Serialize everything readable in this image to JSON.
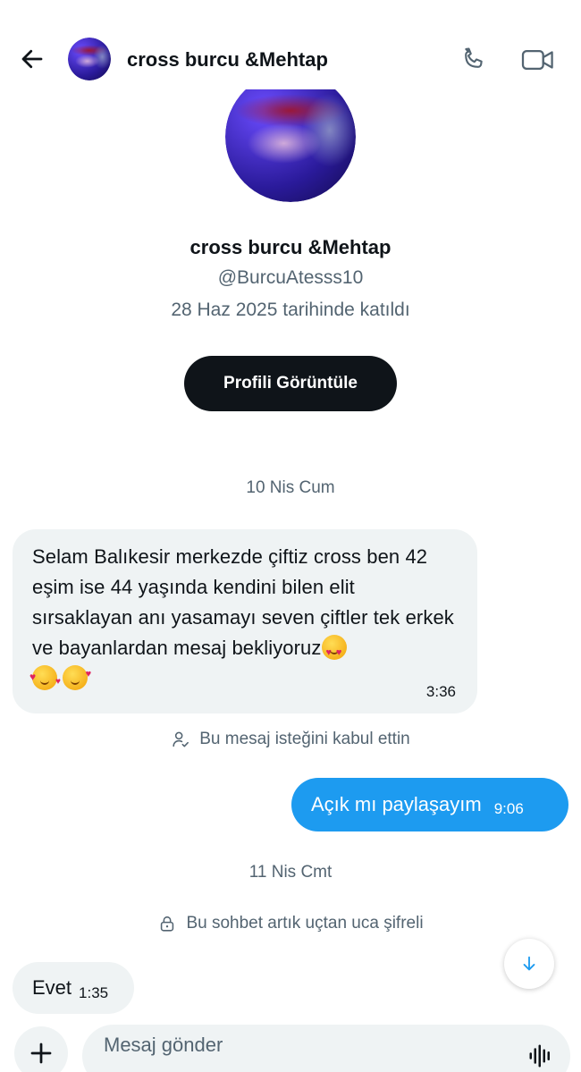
{
  "header": {
    "title": "cross burcu &Mehtap",
    "back_icon": "arrow-left-icon",
    "call_icon": "phone-icon",
    "video_icon": "video-camera-icon"
  },
  "profile": {
    "name": "cross burcu &Mehtap",
    "handle": "@BurcuAtesss10",
    "joined": "28 Haz 2025 tarihinde katıldı",
    "view_button": "Profili Görüntüle"
  },
  "conversation": {
    "date_1": "10 Nis Cum",
    "message_1": {
      "text": "Selam Balıkesir merkezde çiftiz cross ben 42 eşim ise 44 yaşında kendini bilen elit sırsaklayan anı yasamayı seven çiftler tek erkek ve bayanlardan mesaj bekliyoruz",
      "emojis": [
        "smiling-face-heart-eyes",
        "smiling-face-hearts",
        "face-blowing-kiss"
      ],
      "time": "3:36"
    },
    "accepted_note": "Bu mesaj isteğini kabul ettin",
    "message_2": {
      "text": "Açık mı paylaşayım",
      "time": "9:06"
    },
    "date_2": "11 Nis Cmt",
    "encrypted_note": "Bu sohbet artık uçtan uca şifreli",
    "message_3": {
      "text": "Evet",
      "time": "1:35"
    }
  },
  "composer": {
    "placeholder": "Mesaj gönder",
    "add_icon": "plus-icon",
    "voice_icon": "voice-waveform-icon"
  },
  "colors": {
    "accent": "#1d9bf0",
    "incoming_bubble": "#eff3f4",
    "primary_text": "#0f1419",
    "secondary_text": "#536471"
  }
}
